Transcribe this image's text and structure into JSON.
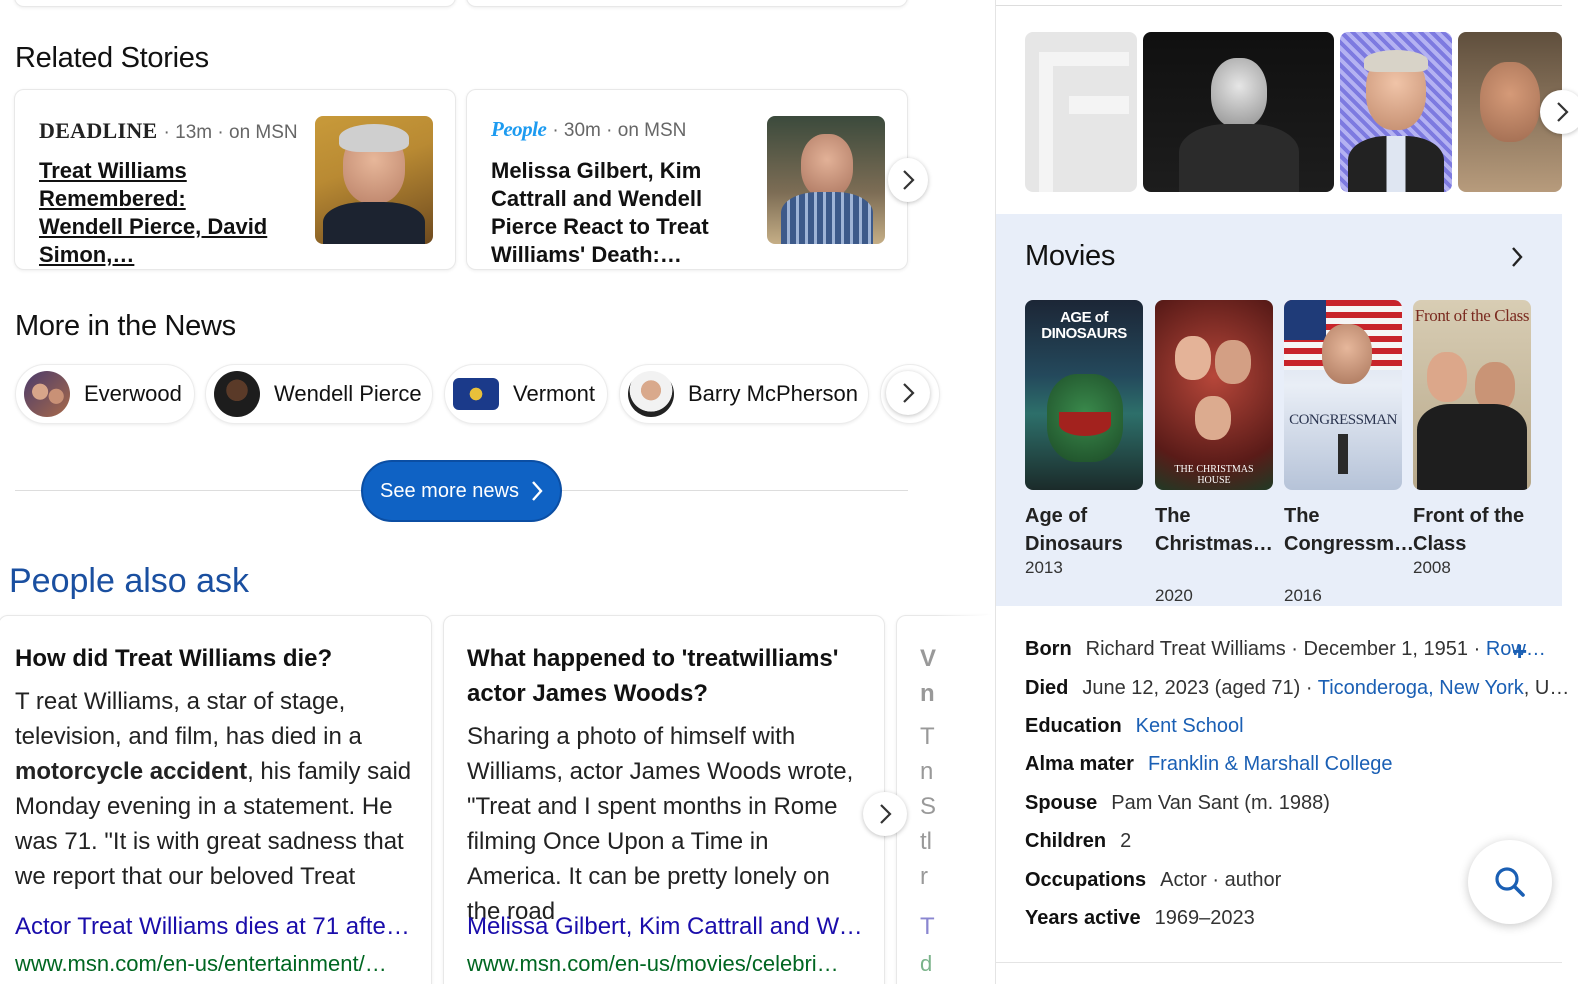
{
  "related": {
    "title": "Related Stories",
    "stories": [
      {
        "source": "DEADLINE",
        "meta": "· 13m · on MSN",
        "headline": "Treat Williams Remembered: Wendell Pierce, David Simon,…"
      },
      {
        "source": "People",
        "meta": "· 30m · on MSN",
        "headline": "Melissa Gilbert, Kim Cattrall and Wendell Pierce React to Treat Williams' Death:…"
      }
    ]
  },
  "more_news": {
    "title": "More in the News",
    "chips": [
      "Everwood",
      "Wendell Pierce",
      "Vermont",
      "Barry McPherson"
    ],
    "see_more": "See more news"
  },
  "paa": {
    "title": "People also ask",
    "cards": [
      {
        "question": "How did Treat Williams die?",
        "answer_pre": "T reat Williams, a star of stage, television, and film, has died in a ",
        "answer_bold": "motorcycle accident",
        "answer_post": ", his family said Monday evening in a statement. He was 71. \"It is with great sadness that we report that our beloved Treat",
        "link": "Actor Treat Williams dies at 71 after…",
        "url": "www.msn.com/en-us/entertainment/…"
      },
      {
        "question": "What happened to 'treatwilliams' actor James Woods?",
        "answer": "Sharing a photo of himself with Williams, actor James Woods wrote, \"Treat and I spent months in Rome filming Once Upon a Time in America. It can be pretty lonely on the road",
        "link": "Melissa Gilbert, Kim Cattrall and We…",
        "url": "www.msn.com/en-us/movies/celebri…"
      },
      {
        "partial_lines": [
          "V",
          "n",
          "T",
          "n",
          "S",
          "tl",
          "r"
        ],
        "link": "T",
        "url": "d"
      }
    ]
  },
  "movies": {
    "title": "Movies",
    "items": [
      {
        "title": "Age of Dinosaurs",
        "year": "2013",
        "poster_text": "AGE of DINOSAURS"
      },
      {
        "title": "The Christmas…",
        "year": "2020",
        "poster_text": "THE CHRISTMAS HOUSE"
      },
      {
        "title": "The Congressm…",
        "year": "2016",
        "poster_text": "CONGRESSMAN"
      },
      {
        "title": "Front of the Class",
        "year": "2008",
        "poster_text": "Front of the Class"
      }
    ]
  },
  "facts": [
    {
      "label": "Born",
      "value": "Richard Treat Williams · December 1, 1951 · ",
      "link": "Row…"
    },
    {
      "label": "Died",
      "value": "June 12, 2023 (aged 71) · ",
      "link": "Ticonderoga, New York",
      "value2": ", U…"
    },
    {
      "label": "Education",
      "link": "Kent School"
    },
    {
      "label": "Alma mater",
      "link": "Franklin & Marshall College"
    },
    {
      "label": "Spouse",
      "value": "Pam Van Sant (m. 1988)"
    },
    {
      "label": "Children",
      "value": "2"
    },
    {
      "label": "Occupations",
      "value": "Actor · author"
    },
    {
      "label": "Years active",
      "value": "1969–2023"
    }
  ],
  "colors": {
    "accent": "#0f62c4",
    "link": "#1a0dab",
    "url": "#006621",
    "panel_bg": "#e8eef9"
  }
}
